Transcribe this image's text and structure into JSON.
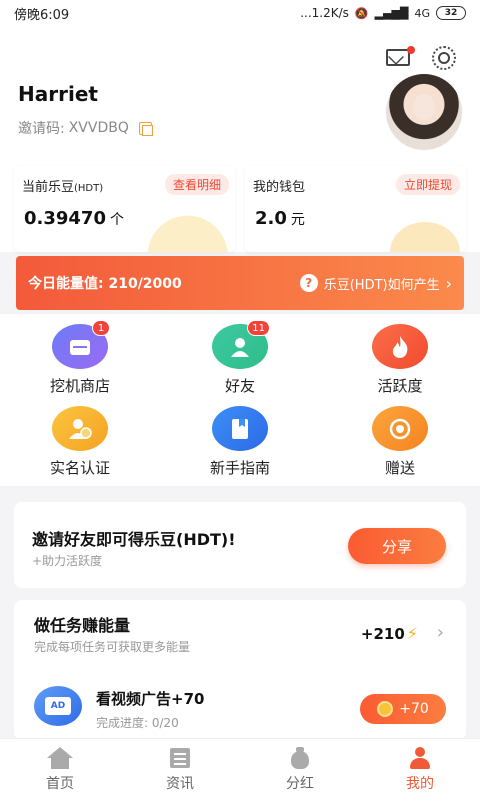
{
  "status_bar": {
    "time": "傍晚6:09",
    "network_speed": "...1.2K/s",
    "signal": "4G",
    "battery": "32"
  },
  "header": {
    "username": "Harriet",
    "invite_label": "邀请码:",
    "invite_code": "XVVDBQ"
  },
  "cards": [
    {
      "label": "当前乐豆",
      "label_suffix": "(HDT)",
      "tag": "查看明细",
      "value": "0.39470",
      "unit": "个"
    },
    {
      "label": "我的钱包",
      "label_suffix": "",
      "tag": "立即提现",
      "value": "2.0",
      "unit": "元"
    }
  ],
  "energy_banner": {
    "left": "今日能量值: 210/2000",
    "help_icon": "?",
    "right": "乐豆(HDT)如何产生",
    "chevron": "›"
  },
  "grid": [
    {
      "label": "挖机商店",
      "icon": "store-icon",
      "badge": "1"
    },
    {
      "label": "好友",
      "icon": "friend-icon",
      "badge": "11"
    },
    {
      "label": "活跃度",
      "icon": "fire-icon",
      "badge": ""
    },
    {
      "label": "实名认证",
      "icon": "id-verify-icon",
      "badge": ""
    },
    {
      "label": "新手指南",
      "icon": "guide-icon",
      "badge": ""
    },
    {
      "label": "赠送",
      "icon": "gift-icon",
      "badge": ""
    }
  ],
  "invite_card": {
    "title": "邀请好友即可得乐豆(HDT)!",
    "subtitle": "+助力活跃度",
    "button": "分享"
  },
  "task_card": {
    "title": "做任务赚能量",
    "subtitle": "完成每项任务可获取更多能量",
    "energy": "+210",
    "chevron": "›",
    "item": {
      "icon_text": "AD",
      "title": "看视频广告+70",
      "progress": "完成进度: 0/20",
      "reward": "+70"
    }
  },
  "tabbar": [
    {
      "label": "首页",
      "active": false
    },
    {
      "label": "资讯",
      "active": false
    },
    {
      "label": "分红",
      "active": false
    },
    {
      "label": "我的",
      "active": true
    }
  ],
  "colors": {
    "accent": "#f05a36",
    "tag_bg": "#fde9e6",
    "bolt": "#f6b31b"
  }
}
